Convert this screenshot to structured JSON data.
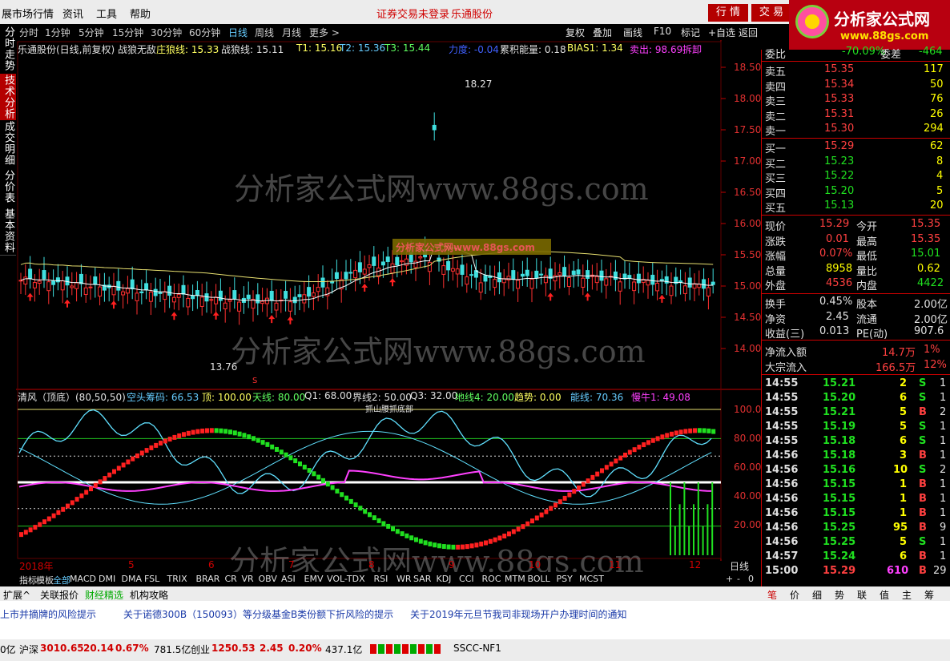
{
  "menu": {
    "items": [
      "展市场行情",
      "资讯",
      "工具",
      "帮助"
    ],
    "security_status": "证券交易未登录",
    "stock_link": "乐通股份",
    "btn_quote": "行 情",
    "btn_trade": "交 易"
  },
  "logo": {
    "title": "分析家公式网",
    "url": "www.88gs.com"
  },
  "periods": {
    "items": [
      "分时",
      "1分钟",
      "5分钟",
      "15分钟",
      "30分钟",
      "60分钟",
      "日线",
      "周线",
      "月线",
      "更多 >"
    ],
    "selected": "日线"
  },
  "toolbar": {
    "items": [
      "复权",
      "叠加",
      "画线",
      "F10",
      "标记",
      "+自选",
      "返回"
    ]
  },
  "left_tabs": [
    {
      "label": "分时走势",
      "selected": false
    },
    {
      "label": "技术分析",
      "selected": true
    },
    {
      "label": "成交明细",
      "selected": false
    },
    {
      "label": "分价表",
      "selected": false
    },
    {
      "label": "基本资料",
      "selected": false
    }
  ],
  "main_header": {
    "title": "乐通股份(日线,前复权) 战狼无敌",
    "zhuanglang": "庄狼线: 15.33",
    "zhanlang": "战狼线: 15.11",
    "t1": "T1: 15.16",
    "t2": "T2: 15.36",
    "t3": "T3: 15.44",
    "lidu": "力度: -0.04",
    "leiji": "累积能量: 0.18",
    "bias": "BIAS1: 1.34",
    "maichu": "卖出: 98.69",
    "zhuangjia": "拆卸"
  },
  "price_axis": [
    "18.50",
    "18.00",
    "17.50",
    "17.00",
    "16.50",
    "16.00",
    "15.50",
    "15.00",
    "14.50",
    "14.00"
  ],
  "annotations": {
    "high": "18.27",
    "low": "13.76",
    "s_mark": "S",
    "banner": "分析家公式网www.88gs.com"
  },
  "watermark": "分析家公式网www.88gs.com",
  "sub_header": {
    "title": "清风（顶底）(80,50,50)",
    "kongtou": "空头筹码: 66.53",
    "ding": "顶: 100.00",
    "tianxian": "天线: 80.00",
    "q1": "Q1: 68.00",
    "jiexian": "界线2: 50.00",
    "q3": "Q3: 32.00",
    "dixian": "地线4: 20.00",
    "qushi": "趋势: 0.00",
    "nengxian": "能线: 70.36",
    "manniu": "慢牛1: 49.08"
  },
  "sub_axis": [
    "100.0",
    "80.00",
    "60.00",
    "40.00",
    "20.00"
  ],
  "sub_banner": "抓山腰抓底部",
  "date_axis": [
    "2018年",
    "5",
    "6",
    "7",
    "8",
    "9",
    "10",
    "11",
    "12"
  ],
  "period_label": "日线",
  "indicator_tabs": [
    "指标",
    "模板",
    "全部",
    "MACD",
    "DMI",
    "DMA",
    "FSL",
    "TRIX",
    "BRAR",
    "CR",
    "VR",
    "OBV",
    "ASI",
    "EMV",
    "VOL-TDX",
    "RSI",
    "WR",
    "SAR",
    "KDJ",
    "CCI",
    "ROC",
    "MTM",
    "BOLL",
    "PSY",
    "MCST"
  ],
  "zoom": [
    "+",
    "-",
    "0"
  ],
  "ext_tabs": [
    "扩展^",
    "关联报价",
    "财经精选",
    "机构攻略"
  ],
  "quote": {
    "weibi_label": "委比",
    "weibi": "-70.09%",
    "weicha_label": "委差",
    "weicha": "-464",
    "sells": [
      {
        "label": "卖五",
        "price": "15.35",
        "vol": "117"
      },
      {
        "label": "卖四",
        "price": "15.34",
        "vol": "50"
      },
      {
        "label": "卖三",
        "price": "15.33",
        "vol": "76"
      },
      {
        "label": "卖二",
        "price": "15.31",
        "vol": "26"
      },
      {
        "label": "卖一",
        "price": "15.30",
        "vol": "294"
      }
    ],
    "buys": [
      {
        "label": "买一",
        "price": "15.29",
        "vol": "62"
      },
      {
        "label": "买二",
        "price": "15.23",
        "vol": "8"
      },
      {
        "label": "买三",
        "price": "15.22",
        "vol": "4"
      },
      {
        "label": "买四",
        "price": "15.20",
        "vol": "5"
      },
      {
        "label": "买五",
        "price": "15.13",
        "vol": "20"
      }
    ],
    "stats": [
      {
        "l1": "现价",
        "v1": "15.29",
        "c1": "#ff4040",
        "l2": "今开",
        "v2": "15.35",
        "c2": "#ff4040"
      },
      {
        "l1": "涨跌",
        "v1": "0.01",
        "c1": "#ff4040",
        "l2": "最高",
        "v2": "15.35",
        "c2": "#ff4040"
      },
      {
        "l1": "涨幅",
        "v1": "0.07%",
        "c1": "#ff4040",
        "l2": "最低",
        "v2": "15.01",
        "c2": "#20e020"
      },
      {
        "l1": "总量",
        "v1": "8958",
        "c1": "#ffff00",
        "l2": "量比",
        "v2": "0.62",
        "c2": "#ffff00"
      },
      {
        "l1": "外盘",
        "v1": "4536",
        "c1": "#ff4040",
        "l2": "内盘",
        "v2": "4422",
        "c2": "#20e020"
      }
    ],
    "stats2": [
      {
        "l1": "换手",
        "v1": "0.45%",
        "l2": "股本",
        "v2": "2.00亿"
      },
      {
        "l1": "净资",
        "v1": "2.45",
        "l2": "流通",
        "v2": "2.00亿"
      },
      {
        "l1": "收益(三)",
        "v1": "0.013",
        "l2": "PE(动)",
        "v2": "907.6"
      }
    ],
    "flow": [
      {
        "label": "净流入额",
        "v": "14.7万",
        "p": "1%"
      },
      {
        "label": "大宗流入",
        "v": "166.5万",
        "p": "12%"
      }
    ],
    "ticks": [
      {
        "t": "14:55",
        "p": "15.21",
        "v": "2",
        "d": "S",
        "n": "1"
      },
      {
        "t": "14:55",
        "p": "15.20",
        "v": "6",
        "d": "S",
        "n": "1"
      },
      {
        "t": "14:55",
        "p": "15.21",
        "v": "5",
        "d": "B",
        "n": "2"
      },
      {
        "t": "14:55",
        "p": "15.19",
        "v": "5",
        "d": "S",
        "n": "1"
      },
      {
        "t": "14:55",
        "p": "15.18",
        "v": "6",
        "d": "S",
        "n": "1"
      },
      {
        "t": "14:56",
        "p": "15.18",
        "v": "3",
        "d": "B",
        "n": "1"
      },
      {
        "t": "14:56",
        "p": "15.16",
        "v": "10",
        "d": "S",
        "n": "2"
      },
      {
        "t": "14:56",
        "p": "15.15",
        "v": "1",
        "d": "B",
        "n": "1"
      },
      {
        "t": "14:56",
        "p": "15.15",
        "v": "1",
        "d": "B",
        "n": "1"
      },
      {
        "t": "14:56",
        "p": "15.15",
        "v": "1",
        "d": "B",
        "n": "1"
      },
      {
        "t": "14:56",
        "p": "15.25",
        "v": "95",
        "d": "B",
        "n": "9"
      },
      {
        "t": "14:56",
        "p": "15.25",
        "v": "5",
        "d": "S",
        "n": "1"
      },
      {
        "t": "14:57",
        "p": "15.24",
        "v": "6",
        "d": "B",
        "n": "1"
      },
      {
        "t": "15:00",
        "p": "15.29",
        "v": "610",
        "d": "B",
        "n": "29"
      }
    ]
  },
  "quote_tabs": [
    "笔",
    "价",
    "细",
    "势",
    "联",
    "值",
    "主",
    "筹"
  ],
  "news": [
    "上市并摘牌的风险提示",
    "关于诺德300B（150093）等分级基金B类份额下折风险的提示",
    "关于2019年元旦节我司非现场开户办理时间的通知"
  ],
  "status": {
    "left": "0亿",
    "sh_label": "沪深",
    "sh_val": "3010.65",
    "sh_chg": "20.14",
    "sh_pct": "0.67%",
    "sh_amt": "781.5亿",
    "cy_label": "创业",
    "cy_val": "1250.53",
    "cy_chg": "2.45",
    "cy_pct": "0.20%",
    "cy_amt": "437.1亿",
    "server": "SSCC-NF1"
  }
}
